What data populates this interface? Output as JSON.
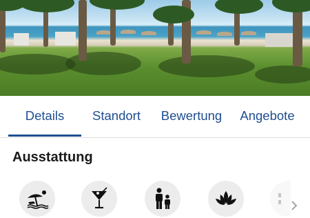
{
  "hero": {
    "icon": "beach-palms-photo"
  },
  "tabs": [
    {
      "label": "Details",
      "active": true
    },
    {
      "label": "Standort",
      "active": false
    },
    {
      "label": "Bewertung",
      "active": false
    },
    {
      "label": "Angebote",
      "active": false
    }
  ],
  "colors": {
    "accent": "#1f4e91",
    "icon_bg": "#ececec",
    "icon": "#111111"
  },
  "amenities": {
    "title": "Ausstattung",
    "items": [
      {
        "icon": "beach-umbrella-icon"
      },
      {
        "icon": "cocktail-icon"
      },
      {
        "icon": "family-icon"
      },
      {
        "icon": "lotus-spa-icon"
      },
      {
        "icon": "partial-amenity-icon"
      }
    ],
    "next_icon": "chevron-right-icon"
  }
}
